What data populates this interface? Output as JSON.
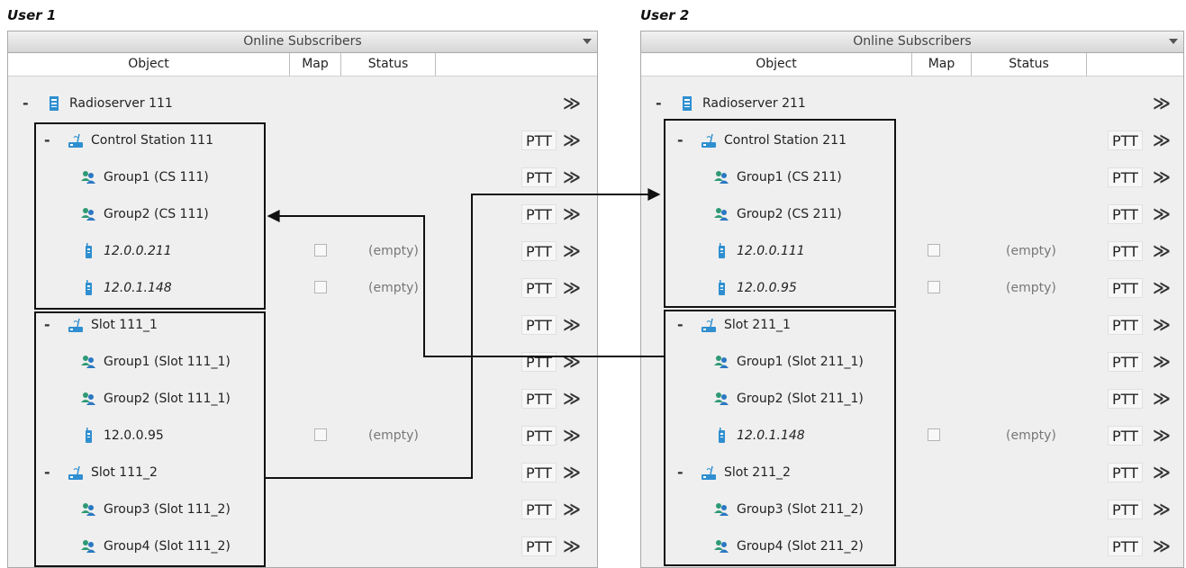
{
  "users": [
    {
      "label": "User 1",
      "panel_title": "Online Subscribers",
      "columns": {
        "object": "Object",
        "map": "Map",
        "status": "Status"
      },
      "rows": [
        {
          "indent": 0,
          "toggle": "-",
          "icon": "server-icon",
          "text": "Radioserver 111",
          "italic": false,
          "map": false,
          "status": "",
          "ptt": false
        },
        {
          "indent": 1,
          "toggle": "-",
          "icon": "station-icon",
          "text": "Control Station 111",
          "italic": false,
          "map": false,
          "status": "",
          "ptt": true
        },
        {
          "indent": 2,
          "toggle": "",
          "icon": "group-icon",
          "text": "Group1 (CS 111)",
          "italic": false,
          "map": false,
          "status": "",
          "ptt": true
        },
        {
          "indent": 2,
          "toggle": "",
          "icon": "group-icon",
          "text": "Group2 (CS 111)",
          "italic": false,
          "map": false,
          "status": "",
          "ptt": true
        },
        {
          "indent": 2,
          "toggle": "",
          "icon": "radio-icon",
          "text": "12.0.0.211",
          "italic": true,
          "map": true,
          "status": "(empty)",
          "ptt": true
        },
        {
          "indent": 2,
          "toggle": "",
          "icon": "radio-icon",
          "text": "12.0.1.148",
          "italic": true,
          "map": true,
          "status": "(empty)",
          "ptt": true
        },
        {
          "indent": 1,
          "toggle": "-",
          "icon": "station-icon",
          "text": "Slot 111_1",
          "italic": false,
          "map": false,
          "status": "",
          "ptt": true
        },
        {
          "indent": 2,
          "toggle": "",
          "icon": "group-icon",
          "text": "Group1 (Slot 111_1)",
          "italic": false,
          "map": false,
          "status": "",
          "ptt": true
        },
        {
          "indent": 2,
          "toggle": "",
          "icon": "group-icon",
          "text": "Group2 (Slot 111_1)",
          "italic": false,
          "map": false,
          "status": "",
          "ptt": true
        },
        {
          "indent": 2,
          "toggle": "",
          "icon": "radio-icon",
          "text": "12.0.0.95",
          "italic": false,
          "map": true,
          "status": "(empty)",
          "ptt": true
        },
        {
          "indent": 1,
          "toggle": "-",
          "icon": "station-icon",
          "text": "Slot 111_2",
          "italic": false,
          "map": false,
          "status": "",
          "ptt": true
        },
        {
          "indent": 2,
          "toggle": "",
          "icon": "group-icon",
          "text": "Group3 (Slot 111_2)",
          "italic": false,
          "map": false,
          "status": "",
          "ptt": true
        },
        {
          "indent": 2,
          "toggle": "",
          "icon": "group-icon",
          "text": "Group4 (Slot 111_2)",
          "italic": false,
          "map": false,
          "status": "",
          "ptt": true
        }
      ]
    },
    {
      "label": "User 2",
      "panel_title": "Online Subscribers",
      "columns": {
        "object": "Object",
        "map": "Map",
        "status": "Status"
      },
      "rows": [
        {
          "indent": 0,
          "toggle": "-",
          "icon": "server-icon",
          "text": "Radioserver 211",
          "italic": false,
          "map": false,
          "status": "",
          "ptt": false
        },
        {
          "indent": 1,
          "toggle": "-",
          "icon": "station-icon",
          "text": "Control Station 211",
          "italic": false,
          "map": false,
          "status": "",
          "ptt": true
        },
        {
          "indent": 2,
          "toggle": "",
          "icon": "group-icon",
          "text": "Group1 (CS 211)",
          "italic": false,
          "map": false,
          "status": "",
          "ptt": true
        },
        {
          "indent": 2,
          "toggle": "",
          "icon": "group-icon",
          "text": "Group2 (CS 211)",
          "italic": false,
          "map": false,
          "status": "",
          "ptt": true
        },
        {
          "indent": 2,
          "toggle": "",
          "icon": "radio-icon",
          "text": "12.0.0.111",
          "italic": true,
          "map": true,
          "status": "(empty)",
          "ptt": true
        },
        {
          "indent": 2,
          "toggle": "",
          "icon": "radio-icon",
          "text": "12.0.0.95",
          "italic": true,
          "map": true,
          "status": "(empty)",
          "ptt": true
        },
        {
          "indent": 1,
          "toggle": "-",
          "icon": "station-icon",
          "text": "Slot 211_1",
          "italic": false,
          "map": false,
          "status": "",
          "ptt": true
        },
        {
          "indent": 2,
          "toggle": "",
          "icon": "group-icon",
          "text": "Group1 (Slot 211_1)",
          "italic": false,
          "map": false,
          "status": "",
          "ptt": true
        },
        {
          "indent": 2,
          "toggle": "",
          "icon": "group-icon",
          "text": "Group2 (Slot 211_1)",
          "italic": false,
          "map": false,
          "status": "",
          "ptt": true
        },
        {
          "indent": 2,
          "toggle": "",
          "icon": "radio-icon",
          "text": "12.0.1.148",
          "italic": true,
          "map": true,
          "status": "(empty)",
          "ptt": true
        },
        {
          "indent": 1,
          "toggle": "-",
          "icon": "station-icon",
          "text": "Slot 211_2",
          "italic": false,
          "map": false,
          "status": "",
          "ptt": true
        },
        {
          "indent": 2,
          "toggle": "",
          "icon": "group-icon",
          "text": "Group3 (Slot 211_2)",
          "italic": false,
          "map": false,
          "status": "",
          "ptt": true
        },
        {
          "indent": 2,
          "toggle": "",
          "icon": "group-icon",
          "text": "Group4 (Slot 211_2)",
          "italic": false,
          "map": false,
          "status": "",
          "ptt": true
        }
      ]
    }
  ],
  "ptt_label": "PTT",
  "more_label": "≫",
  "colors": {
    "server_icon": "#2f8fd0",
    "group_icon_a": "#2e9a74",
    "group_icon_b": "#2b78c2",
    "radio_icon": "#2f8fd0",
    "station_icon": "#2f8fd0",
    "frame": "#111111"
  }
}
